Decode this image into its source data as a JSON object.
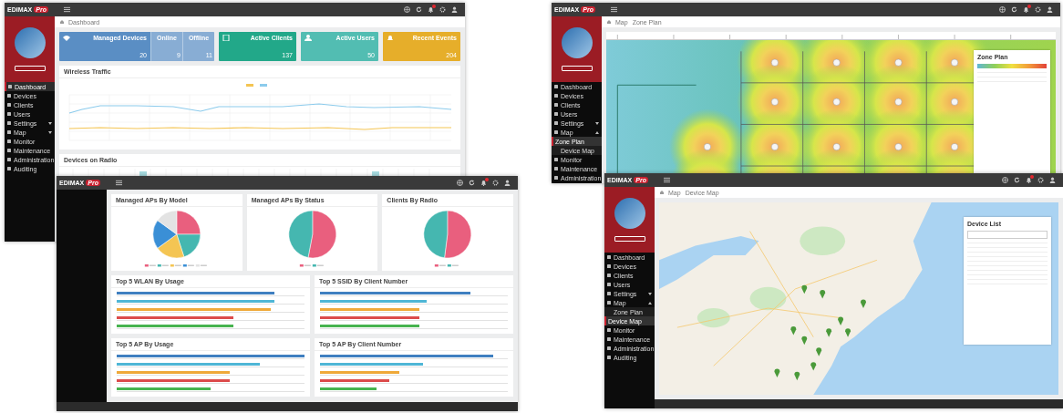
{
  "windows": [
    {
      "kind": "dashboard",
      "logo": "EDIMAX",
      "logo_badge": "Pro",
      "profile": true,
      "sidebar": [
        {
          "label": "Dashboard",
          "selected": true
        },
        {
          "label": "Devices",
          "selected": false
        },
        {
          "label": "Clients",
          "selected": false
        },
        {
          "label": "Users",
          "selected": false
        },
        {
          "label": "Settings",
          "selected": false,
          "expanded": false
        },
        {
          "label": "Map",
          "selected": false,
          "expanded": false
        },
        {
          "label": "Monitor",
          "selected": false
        },
        {
          "label": "Maintenance",
          "selected": false
        },
        {
          "label": "Administration",
          "selected": false
        },
        {
          "label": "Auditing",
          "selected": false
        }
      ],
      "breadcrumb": [
        "Dashboard"
      ],
      "tiles": [
        {
          "label": "Managed Devices",
          "value": "20",
          "color": "#5a8ec4",
          "parts": [
            {
              "label": "Online",
              "value": "9"
            },
            {
              "label": "Offline",
              "value": "11"
            }
          ]
        },
        {
          "label": "Active Clients",
          "value": "137",
          "color": "#22a889"
        },
        {
          "label": "Active Users",
          "value": "50",
          "color": "#52bdb2"
        },
        {
          "label": "Recent Events",
          "value": "204",
          "color": "#e6ae2a"
        }
      ],
      "panels": [
        {
          "kind": "line",
          "title": "Wireless Traffic"
        },
        {
          "kind": "bars",
          "title": "Devices on Radio"
        }
      ]
    },
    {
      "kind": "charts",
      "logo": "EDIMAX",
      "logo_badge": "Pro",
      "profile": false,
      "pies": [
        {
          "title": "Managed APs By Model"
        },
        {
          "title": "Managed APs By Status"
        },
        {
          "title": "Clients By Radio"
        }
      ],
      "lists": [
        {
          "title": "Top 5 WLAN By Usage",
          "rows": [
            {
              "level": 0.84,
              "color": "#3f7fc0"
            },
            {
              "level": 0.84,
              "color": "#4fb6d6"
            },
            {
              "level": 0.82,
              "color": "#efa93a"
            },
            {
              "level": 0.62,
              "color": "#dc4b4b"
            },
            {
              "level": 0.62,
              "color": "#47b34f"
            }
          ]
        },
        {
          "title": "Top 5 SSID By Client Number",
          "rows": [
            {
              "level": 0.8,
              "color": "#3f7fc0"
            },
            {
              "level": 0.57,
              "color": "#4fb6d6"
            },
            {
              "level": 0.53,
              "color": "#efa93a"
            },
            {
              "level": 0.53,
              "color": "#dc4b4b"
            },
            {
              "level": 0.53,
              "color": "#47b34f"
            }
          ]
        },
        {
          "title": "Top 5 AP By Usage",
          "rows": [
            {
              "level": 1,
              "color": "#3f7fc0"
            },
            {
              "level": 0.76,
              "color": "#4fb6d6"
            },
            {
              "level": 0.6,
              "color": "#efa93a"
            },
            {
              "level": 0.6,
              "color": "#dc4b4b"
            },
            {
              "level": 0.5,
              "color": "#47b34f"
            }
          ]
        },
        {
          "title": "Top 5 AP By Client Number",
          "rows": [
            {
              "level": 0.92,
              "color": "#3f7fc0"
            },
            {
              "level": 0.55,
              "color": "#4fb6d6"
            },
            {
              "level": 0.42,
              "color": "#efa93a"
            },
            {
              "level": 0.37,
              "color": "#dc4b4b"
            },
            {
              "level": 0.3,
              "color": "#47b34f"
            }
          ]
        }
      ]
    },
    {
      "kind": "zone",
      "logo": "EDIMAX",
      "logo_badge": "Pro",
      "profile": true,
      "sidebar": [
        {
          "label": "Dashboard",
          "selected": false
        },
        {
          "label": "Devices",
          "selected": false
        },
        {
          "label": "Clients",
          "selected": false
        },
        {
          "label": "Users",
          "selected": false
        },
        {
          "label": "Settings",
          "selected": false,
          "expanded": false
        },
        {
          "label": "Map",
          "selected": false,
          "expanded": true,
          "children": [
            {
              "label": "Zone Plan",
              "selected": true
            },
            {
              "label": "Device Map",
              "selected": false
            }
          ]
        },
        {
          "label": "Monitor",
          "selected": false
        },
        {
          "label": "Maintenance",
          "selected": false
        },
        {
          "label": "Administration",
          "selected": false
        }
      ],
      "breadcrumb": [
        "Map",
        "Zone Plan"
      ],
      "panel_title": "Zone Plan"
    },
    {
      "kind": "map",
      "logo": "EDIMAX",
      "logo_badge": "Pro",
      "profile": true,
      "sidebar": [
        {
          "label": "Dashboard",
          "selected": false
        },
        {
          "label": "Devices",
          "selected": false
        },
        {
          "label": "Clients",
          "selected": false
        },
        {
          "label": "Users",
          "selected": false
        },
        {
          "label": "Settings",
          "selected": false,
          "expanded": false
        },
        {
          "label": "Map",
          "selected": false,
          "expanded": true,
          "children": [
            {
              "label": "Zone Plan",
              "selected": false
            },
            {
              "label": "Device Map",
              "selected": true
            }
          ]
        },
        {
          "label": "Monitor",
          "selected": false
        },
        {
          "label": "Maintenance",
          "selected": false
        },
        {
          "label": "Administration",
          "selected": false
        },
        {
          "label": "Auditing",
          "selected": false
        }
      ],
      "breadcrumb": [
        "Map",
        "Device Map"
      ],
      "panel_title": "Device List"
    }
  ]
}
